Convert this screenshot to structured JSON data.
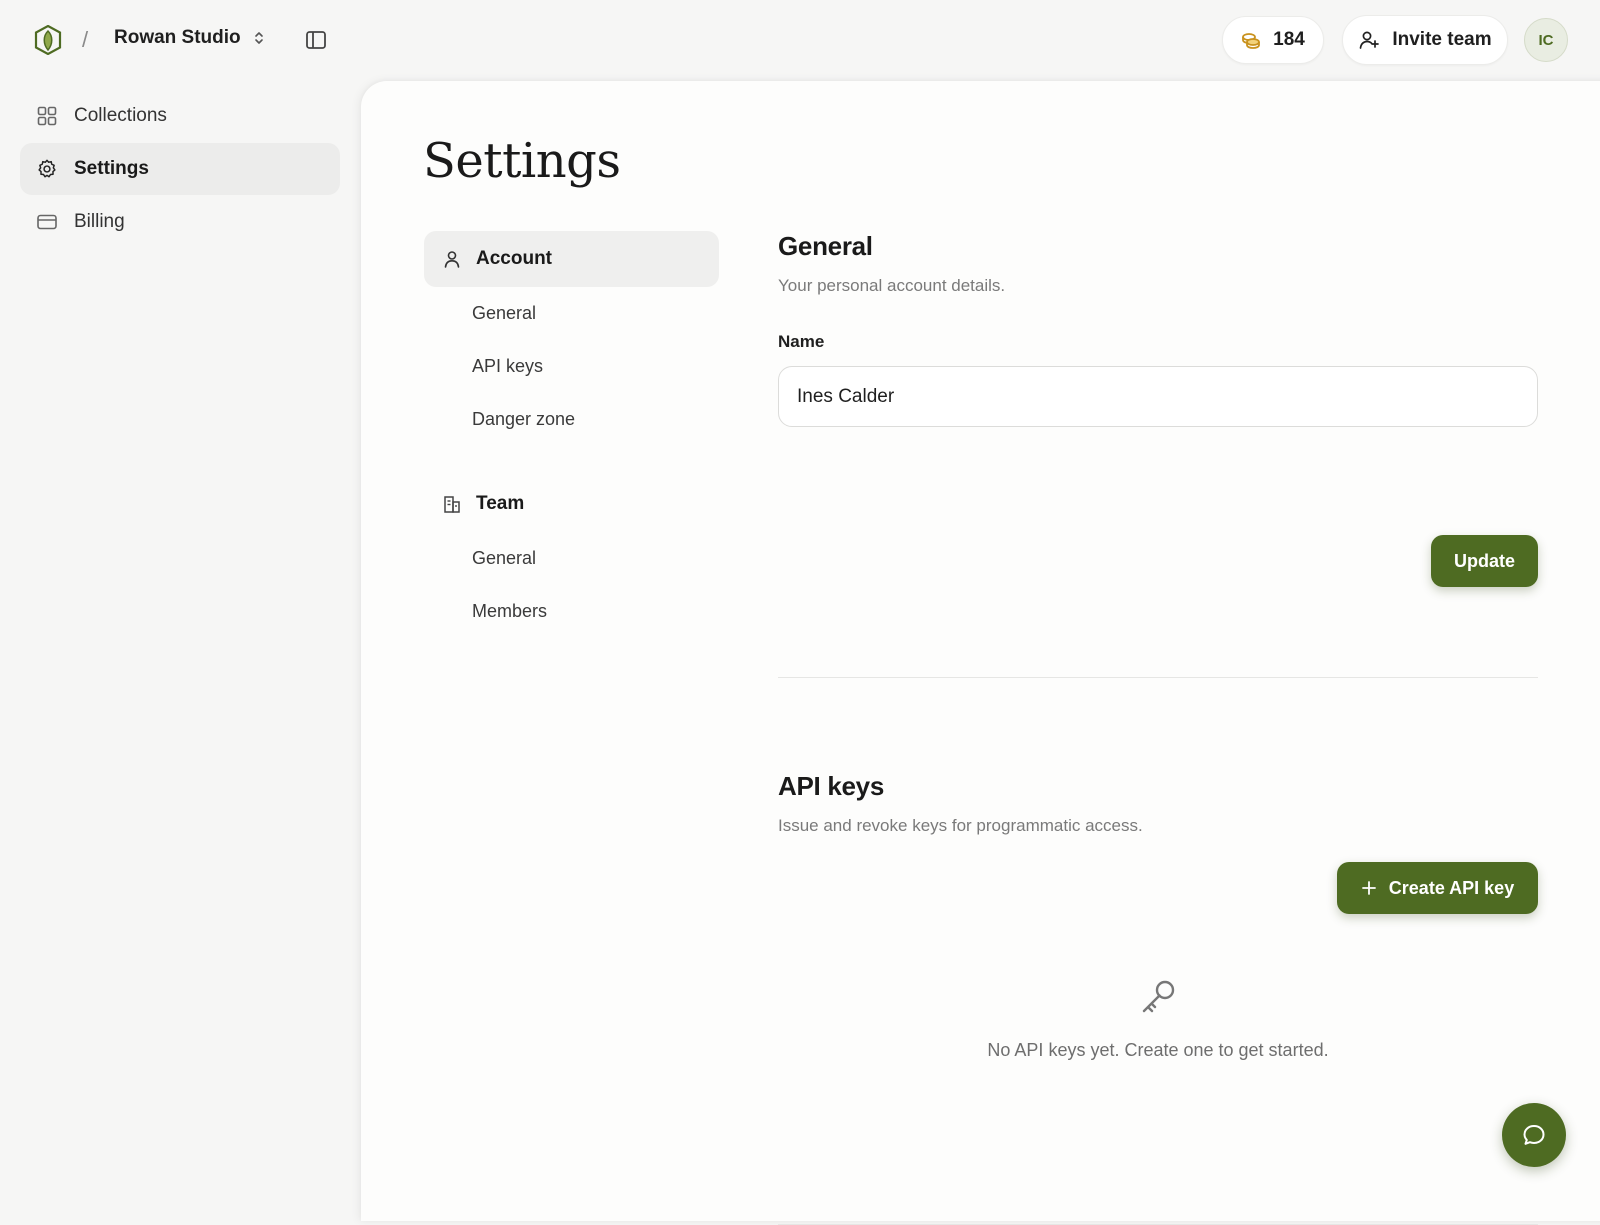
{
  "header": {
    "breadcrumb_separator": "/",
    "workspace_name": "Rowan Studio",
    "credits": "184",
    "invite_label": "Invite team",
    "avatar_initials": "IC"
  },
  "sidebar": {
    "items": [
      {
        "label": "Collections",
        "icon": "grid-icon"
      },
      {
        "label": "Settings",
        "icon": "gear-icon",
        "active": true
      },
      {
        "label": "Billing",
        "icon": "card-icon"
      }
    ]
  },
  "page": {
    "title": "Settings"
  },
  "subnav": {
    "account": {
      "label": "Account",
      "items": [
        "General",
        "API keys",
        "Danger zone"
      ]
    },
    "team": {
      "label": "Team",
      "items": [
        "General",
        "Members"
      ]
    }
  },
  "general": {
    "title": "General",
    "description": "Your personal account details.",
    "name_label": "Name",
    "name_value": "Ines Calder",
    "update_label": "Update"
  },
  "api_keys": {
    "title": "API keys",
    "description": "Issue and revoke keys for programmatic access.",
    "create_label": "Create API key",
    "empty_text": "No API keys yet. Create one to get started."
  },
  "colors": {
    "brand": "#4e6b22",
    "background": "#f6f6f5",
    "surface": "#fdfdfc"
  }
}
